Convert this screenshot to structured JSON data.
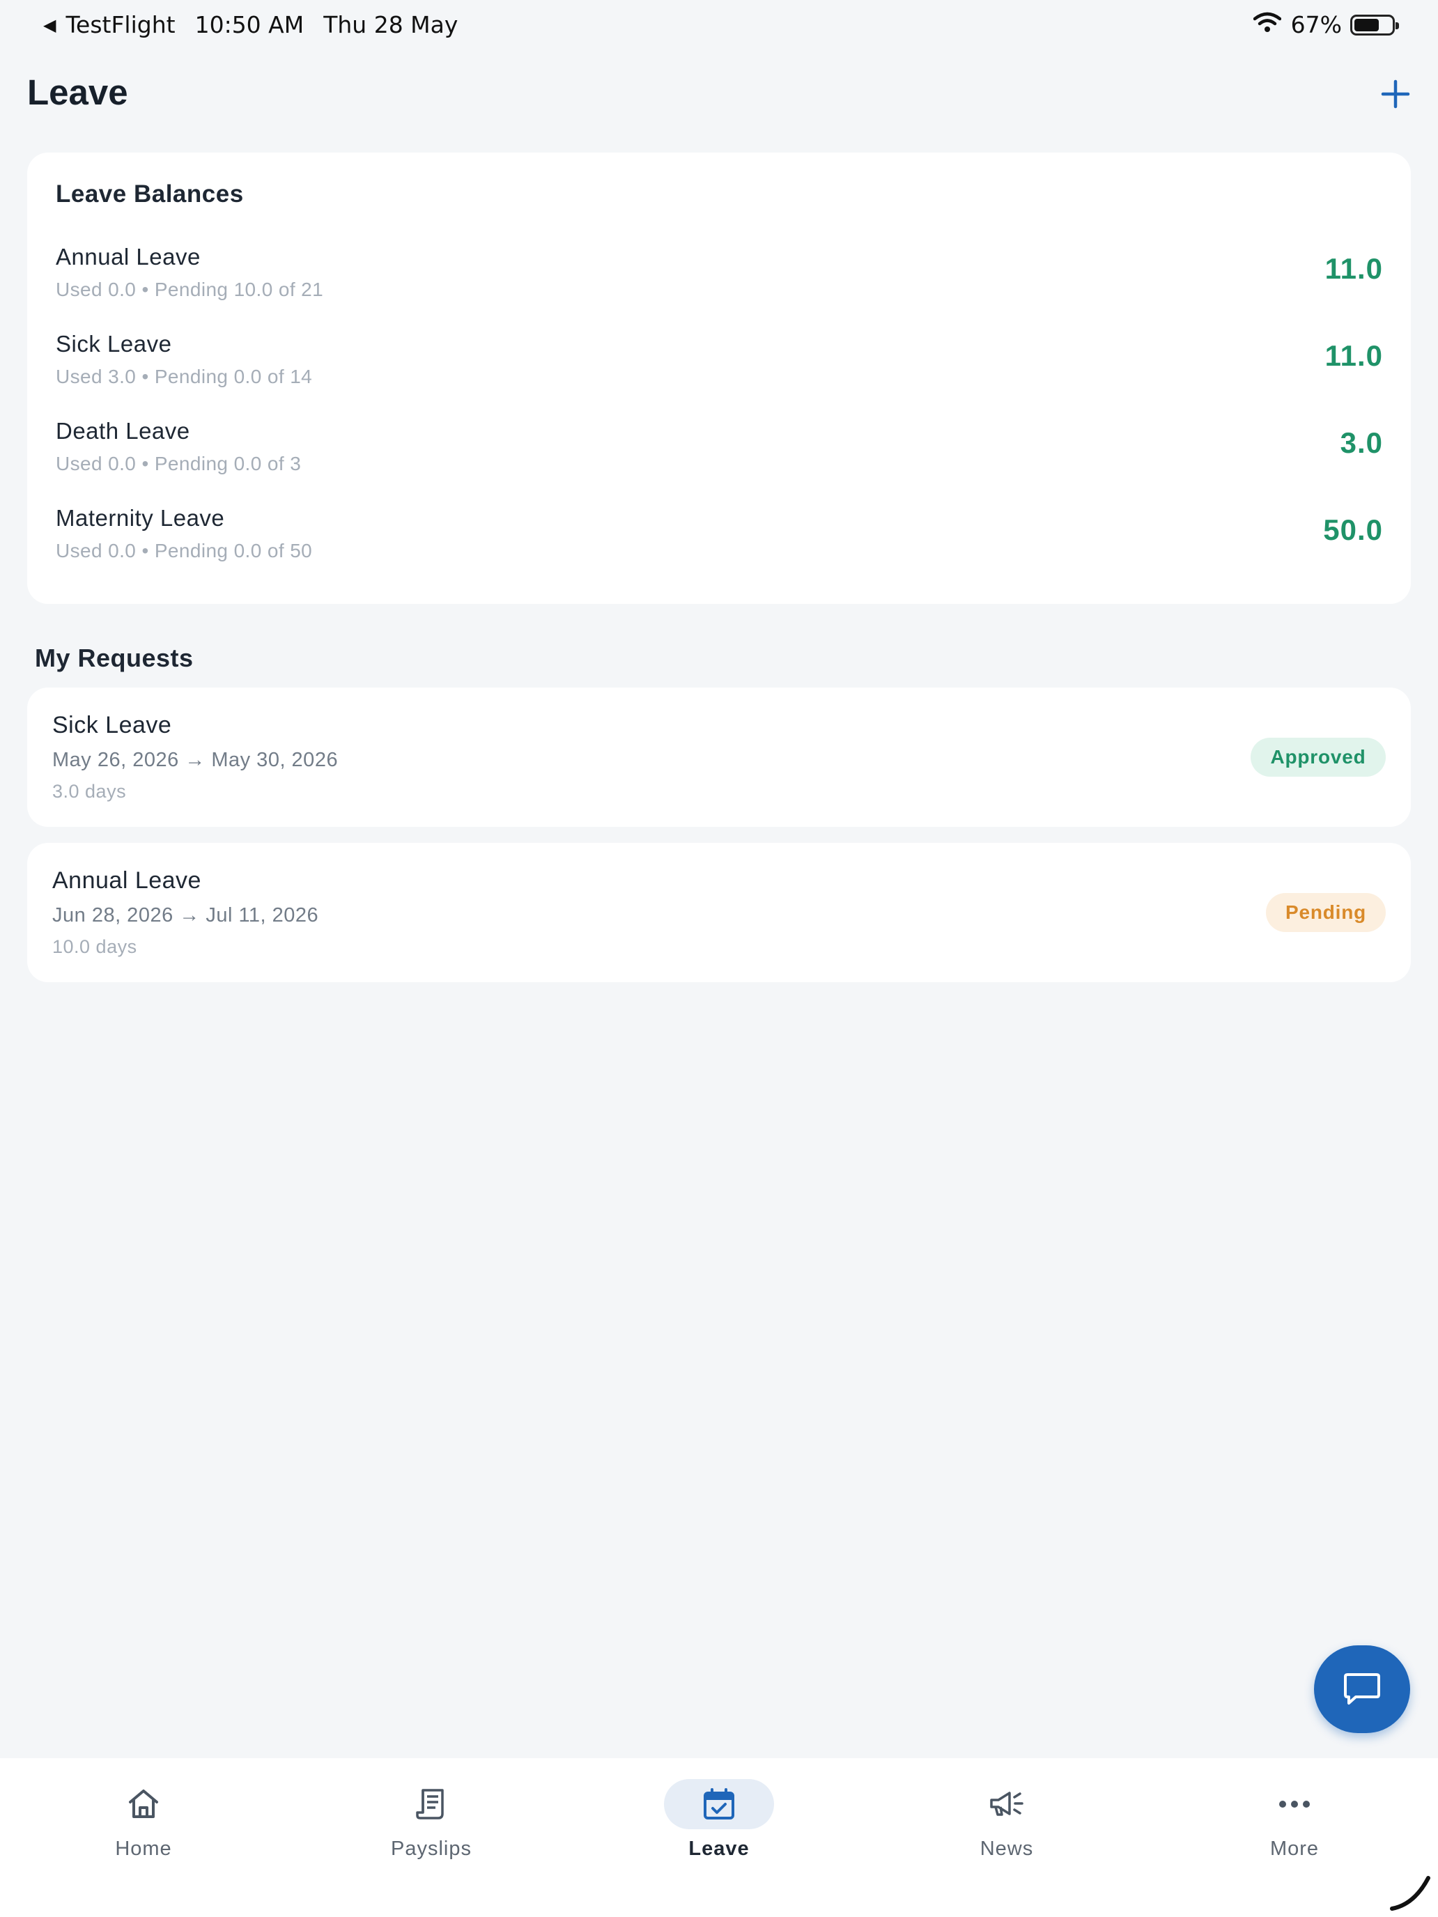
{
  "status_bar": {
    "back_app": "TestFlight",
    "time": "10:50 AM",
    "date": "Thu 28 May",
    "battery": "67%"
  },
  "header": {
    "title": "Leave",
    "add_icon": "plus-icon"
  },
  "balances": {
    "title": "Leave Balances",
    "items": [
      {
        "name": "Annual Leave",
        "meta": "Used 0.0 • Pending 10.0 of 21",
        "value": "11.0"
      },
      {
        "name": "Sick Leave",
        "meta": "Used 3.0 • Pending 0.0 of 14",
        "value": "11.0"
      },
      {
        "name": "Death Leave",
        "meta": "Used 0.0 • Pending 0.0 of 3",
        "value": "3.0"
      },
      {
        "name": "Maternity Leave",
        "meta": "Used 0.0 • Pending 0.0 of 50",
        "value": "50.0"
      }
    ]
  },
  "requests": {
    "title": "My Requests",
    "items": [
      {
        "type": "Sick Leave",
        "dates": "May 26, 2026 → May 30, 2026",
        "days": "3.0 days",
        "status": "Approved"
      },
      {
        "type": "Annual Leave",
        "dates": "Jun 28, 2026 → Jul 11, 2026",
        "days": "10.0 days",
        "status": "Pending"
      }
    ]
  },
  "fab": {
    "icon": "chat-icon"
  },
  "tabs": [
    {
      "label": "Home",
      "icon": "home-icon"
    },
    {
      "label": "Payslips",
      "icon": "receipt-icon"
    },
    {
      "label": "Leave",
      "icon": "calendar-check-icon",
      "active": true
    },
    {
      "label": "News",
      "icon": "megaphone-icon"
    },
    {
      "label": "More",
      "icon": "more-dots-icon"
    }
  ],
  "colors": {
    "accent": "#1f66b9",
    "balance_green": "#1f9268",
    "approved_bg": "#e1f4ec",
    "pending_bg": "#fcefdf",
    "pending_text": "#d98a2a",
    "background": "#f4f6f8"
  }
}
